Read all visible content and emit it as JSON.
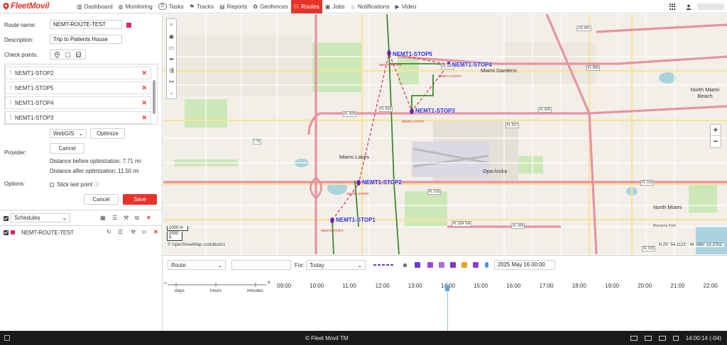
{
  "app": {
    "logo_text": "FleetMovil"
  },
  "nav": [
    {
      "label": "Dashboard",
      "icon": "bar-chart-icon",
      "glyph": "▥"
    },
    {
      "label": "Monitoring",
      "icon": "globe-icon",
      "glyph": "◍"
    },
    {
      "label": "Tasks",
      "icon": "tasks-badge",
      "badge": "0"
    },
    {
      "label": "Tracks",
      "icon": "tracks-icon",
      "glyph": "⚑"
    },
    {
      "label": "Reports",
      "icon": "report-icon",
      "glyph": "▤"
    },
    {
      "label": "Geofences",
      "icon": "geofence-icon",
      "glyph": "✿"
    },
    {
      "label": "Routes",
      "icon": "routes-icon",
      "glyph": "⚇",
      "active": true
    },
    {
      "label": "Jobs",
      "icon": "jobs-icon",
      "glyph": "▣"
    },
    {
      "label": "Notifications",
      "icon": "bell-icon",
      "glyph": "♨"
    },
    {
      "label": "Video",
      "icon": "video-icon",
      "glyph": "▶"
    }
  ],
  "route_form": {
    "name_label": "Route name:",
    "name_value": "NEMT-ROUTE-TEST",
    "route_color": "#e0245e",
    "description_label": "Description:",
    "description_value": "Trip to Patients House",
    "checkpoints_label": "Check points:",
    "stops": [
      "NEMT1-STOP2",
      "NEMT1-STOP5",
      "NEMT1-STOP4",
      "NEMT1-STOP3"
    ],
    "provider_label": "Provider:",
    "provider_select": "WebGIS",
    "optimize_label": "Optimize",
    "cancel_small_label": "Cancel",
    "distance_before": "Distance before optimization: 7.71 mi",
    "distance_after": "Distance after optimization: 11.50 mi",
    "options_label": "Options:",
    "stick_last_point": "Stick last point",
    "cancel_label": "Cancel",
    "save_label": "Save"
  },
  "schedules": {
    "select_label": "Schedules",
    "route_item": "NEMT-ROUTE-TEST"
  },
  "map": {
    "scale_top": "1000 m",
    "scale_bottom": "2000 ft",
    "attribution": "© OpenStreetMap contributors",
    "coords": "N 25° 54.1123' : W -080° 22.2702'",
    "stops": [
      {
        "label": "NEMT1-STOP5",
        "sub": "NEMT1-STOP5"
      },
      {
        "label": "NEMT1-STOP4",
        "sub": "NEMT1-STOP4"
      },
      {
        "label": "NEMT1-STOP3",
        "sub": "NEMT1-STOP3"
      },
      {
        "label": "NEMT1-STOP2",
        "sub": "NEMT1-STOP2"
      },
      {
        "label": "NEMT1-STOP1",
        "sub": "NEMT1-STOP1"
      }
    ],
    "places": [
      "Miami Gardens",
      "Miami Lakes",
      "Opa-locka",
      "North Miami Beach",
      "North Miami",
      "Biscayne Park"
    ],
    "roads": [
      "FL 826",
      "FL 826",
      "FL 847",
      "FL 860",
      "FL 823",
      "FL 817",
      "FL 916",
      "FL 916",
      "FL 924 Toll",
      "FL 924",
      "FL 915",
      "US 441",
      "I 75"
    ],
    "route_color": "#e0245e",
    "track_color": "#3d8a2a"
  },
  "timeline": {
    "type_select": "Route",
    "search_value": "",
    "for_label": "For:",
    "for_select": "Today",
    "datetime": "2025 May 16 00:00",
    "scale_labels": [
      "days",
      "hours",
      "minutes"
    ],
    "hours": [
      "09:00",
      "10:00",
      "11:00",
      "12:00",
      "13:00",
      "14:00",
      "15:00",
      "16:00",
      "17:00",
      "18:00",
      "19:00",
      "20:00",
      "21:00",
      "22:00"
    ]
  },
  "footer": {
    "copyright": "© Fleet Movil TM",
    "clock": "14:00:14 (-04)"
  }
}
